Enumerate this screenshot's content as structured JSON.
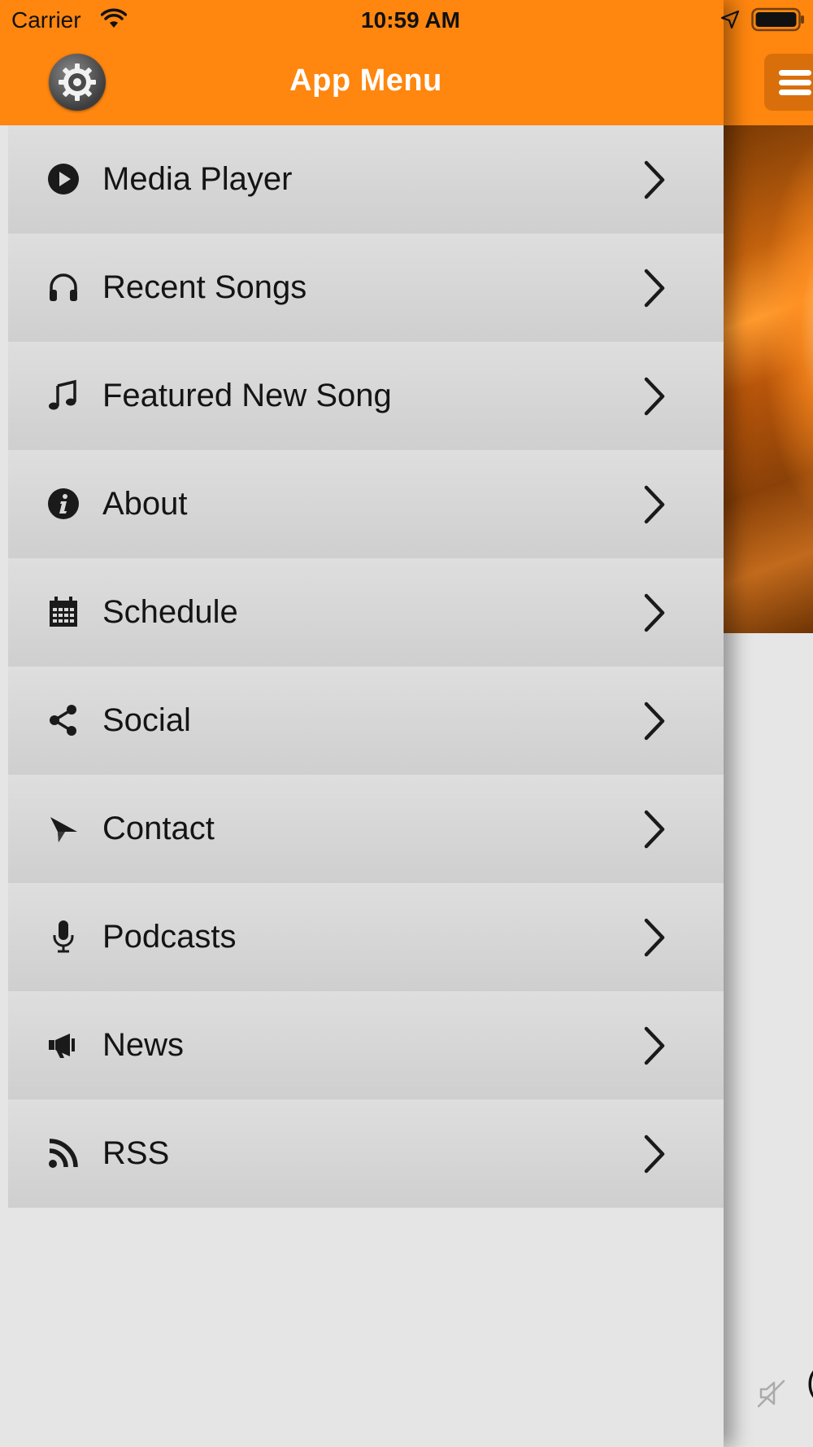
{
  "status_bar": {
    "carrier": "Carrier",
    "time": "10:59 AM"
  },
  "drawer": {
    "title": "App Menu",
    "items": [
      {
        "label": "Media Player",
        "icon": "play-circle-icon"
      },
      {
        "label": "Recent Songs",
        "icon": "headphones-icon"
      },
      {
        "label": "Featured New Song",
        "icon": "music-note-icon"
      },
      {
        "label": "About",
        "icon": "info-icon"
      },
      {
        "label": "Schedule",
        "icon": "calendar-icon"
      },
      {
        "label": "Social",
        "icon": "share-icon"
      },
      {
        "label": "Contact",
        "icon": "paper-plane-icon"
      },
      {
        "label": "Podcasts",
        "icon": "microphone-icon"
      },
      {
        "label": "News",
        "icon": "megaphone-icon"
      },
      {
        "label": "RSS",
        "icon": "rss-icon"
      }
    ]
  },
  "colors": {
    "header": "#ff860f",
    "menu_bg": "#d6d6d6",
    "page_bg": "#e5e5e5"
  }
}
